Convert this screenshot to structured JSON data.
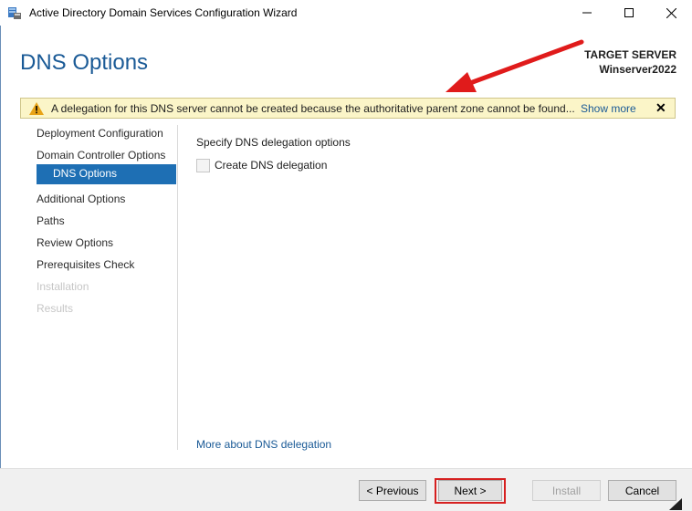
{
  "window": {
    "title": "Active Directory Domain Services Configuration Wizard",
    "app_icon": "server-wizard-icon",
    "minimize_icon": "minimize-icon",
    "maximize_icon": "maximize-icon",
    "close_icon": "close-icon"
  },
  "header": {
    "page_title": "DNS Options",
    "target_label": "TARGET SERVER",
    "target_name": "Winserver2022"
  },
  "banner": {
    "icon": "warning-icon",
    "message": "A delegation for this DNS server cannot be created because the authoritative parent zone cannot be found...",
    "show_more": "Show more",
    "dismiss": "✕",
    "color": "#fbf5c8"
  },
  "nav": {
    "items": [
      {
        "label": "Deployment Configuration",
        "state": "normal"
      },
      {
        "label": "Domain Controller Options",
        "state": "normal"
      },
      {
        "label": "DNS Options",
        "state": "selected"
      },
      {
        "label": "Additional Options",
        "state": "normal"
      },
      {
        "label": "Paths",
        "state": "normal"
      },
      {
        "label": "Review Options",
        "state": "normal"
      },
      {
        "label": "Prerequisites Check",
        "state": "normal"
      },
      {
        "label": "Installation",
        "state": "disabled"
      },
      {
        "label": "Results",
        "state": "disabled"
      }
    ],
    "selected_color": "#1e6fb4"
  },
  "content": {
    "section_label": "Specify DNS delegation options",
    "checkbox_label": "Create DNS delegation",
    "checkbox_checked": false,
    "checkbox_enabled": false,
    "more_link": "More about DNS delegation"
  },
  "footer": {
    "previous_label": "< Previous",
    "next_label": "Next >",
    "install_label": "Install",
    "cancel_label": "Cancel"
  },
  "annotations": {
    "arrow_color": "#e01b1b",
    "highlight_color": "#d62020"
  }
}
